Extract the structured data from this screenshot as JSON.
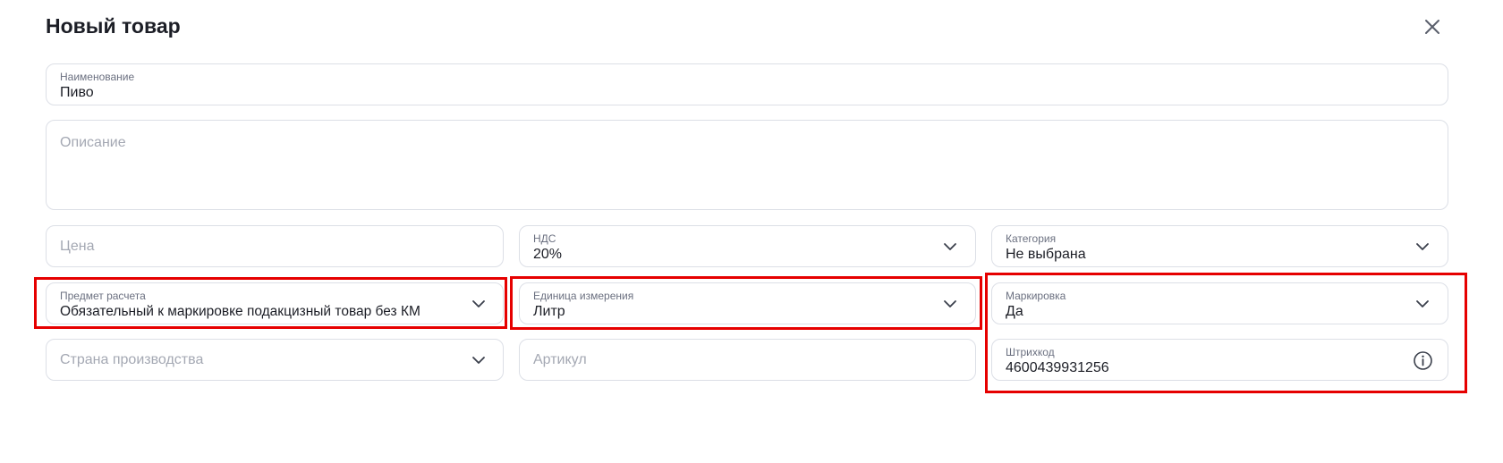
{
  "modal": {
    "title": "Новый товар"
  },
  "fields": {
    "name": {
      "label": "Наименование",
      "value": "Пиво"
    },
    "description": {
      "placeholder": "Описание"
    },
    "price": {
      "placeholder": "Цена"
    },
    "vat": {
      "label": "НДС",
      "value": "20%"
    },
    "category": {
      "label": "Категория",
      "value": "Не выбрана"
    },
    "payment_subject": {
      "label": "Предмет расчета",
      "value": "Обязательный к маркировке подакцизный товар без КМ"
    },
    "unit": {
      "label": "Единица измерения",
      "value": "Литр"
    },
    "marking": {
      "label": "Маркировка",
      "value": "Да"
    },
    "country": {
      "placeholder": "Страна производства"
    },
    "article": {
      "placeholder": "Артикул"
    },
    "barcode": {
      "label": "Штрихкод",
      "value": "4600439931256"
    }
  },
  "colors": {
    "highlight": "#e60000",
    "border": "#dcdfe6",
    "placeholder": "#a4a8b3"
  }
}
